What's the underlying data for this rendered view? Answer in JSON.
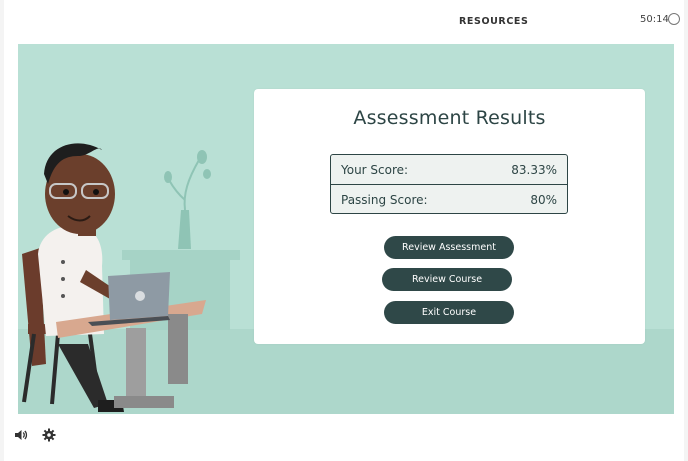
{
  "header": {
    "resources_label": "RESOURCES",
    "timer": "50:14",
    "timer_icon": "timer-ring-icon"
  },
  "results": {
    "title": "Assessment Results",
    "rows": [
      {
        "label": "Your Score:",
        "value": "83.33%"
      },
      {
        "label": "Passing Score:",
        "value": "80%"
      }
    ],
    "buttons": {
      "review_assessment": "Review Assessment",
      "review_course": "Review Course",
      "exit_course": "Exit Course"
    }
  },
  "footer": {
    "volume_icon": "volume-icon",
    "settings_icon": "gear-icon"
  },
  "colors": {
    "stage_bg": "#b9e0d5",
    "button_bg": "#2f4848",
    "text_dark": "#2d4545"
  }
}
